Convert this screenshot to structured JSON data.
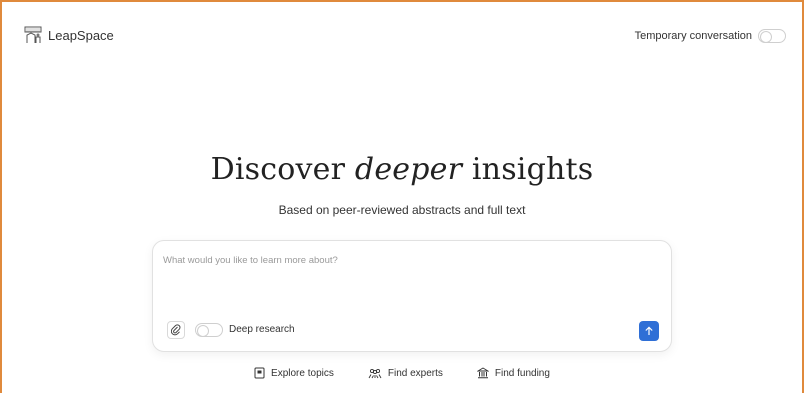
{
  "app": {
    "name": "LeapSpace"
  },
  "header": {
    "temporary_label": "Temporary conversation"
  },
  "hero": {
    "title_before": "Discover ",
    "title_em": "deeper",
    "title_after": " insights",
    "subtitle": "Based on peer-reviewed abstracts and full text"
  },
  "query": {
    "placeholder": "What would you like to learn more about?",
    "deep_research_label": "Deep research"
  },
  "actions": [
    {
      "label": "Explore topics",
      "icon": "book-icon"
    },
    {
      "label": "Find experts",
      "icon": "people-icon"
    },
    {
      "label": "Find funding",
      "icon": "bank-icon"
    }
  ],
  "colors": {
    "frame": "#e08a3c",
    "send_button": "#2f6fd6"
  }
}
